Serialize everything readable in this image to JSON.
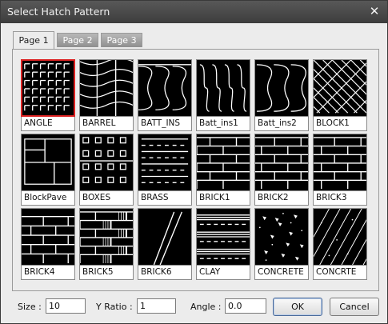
{
  "window": {
    "title": "Select Hatch Pattern",
    "close_glyph": "✕"
  },
  "tabs": [
    {
      "label": "Page 1",
      "active": true
    },
    {
      "label": "Page 2",
      "active": false
    },
    {
      "label": "Page 3",
      "active": false
    }
  ],
  "patterns": [
    {
      "name": "ANGLE",
      "selected": true
    },
    {
      "name": "BARREL"
    },
    {
      "name": "BATT_INS"
    },
    {
      "name": "Batt_ins1"
    },
    {
      "name": "Batt_ins2"
    },
    {
      "name": "BLOCK1"
    },
    {
      "name": "BlockPave"
    },
    {
      "name": "BOXES"
    },
    {
      "name": "BRASS"
    },
    {
      "name": "BRICK1"
    },
    {
      "name": "BRICK2"
    },
    {
      "name": "BRICK3"
    },
    {
      "name": "BRICK4"
    },
    {
      "name": "BRICK5"
    },
    {
      "name": "BRICK6"
    },
    {
      "name": "CLAY"
    },
    {
      "name": "CONCRETE"
    },
    {
      "name": "CONCRTE"
    }
  ],
  "bottom": {
    "size_label": "Size :",
    "size_value": "10",
    "yratio_label": "Y Ratio :",
    "yratio_value": "1",
    "angle_label": "Angle :",
    "angle_value": "0.0",
    "ok_label": "OK",
    "cancel_label": "Cancel"
  },
  "colors": {
    "selection": "#d22222",
    "thumb_bg": "#000000",
    "pattern_stroke": "#ffffff"
  }
}
